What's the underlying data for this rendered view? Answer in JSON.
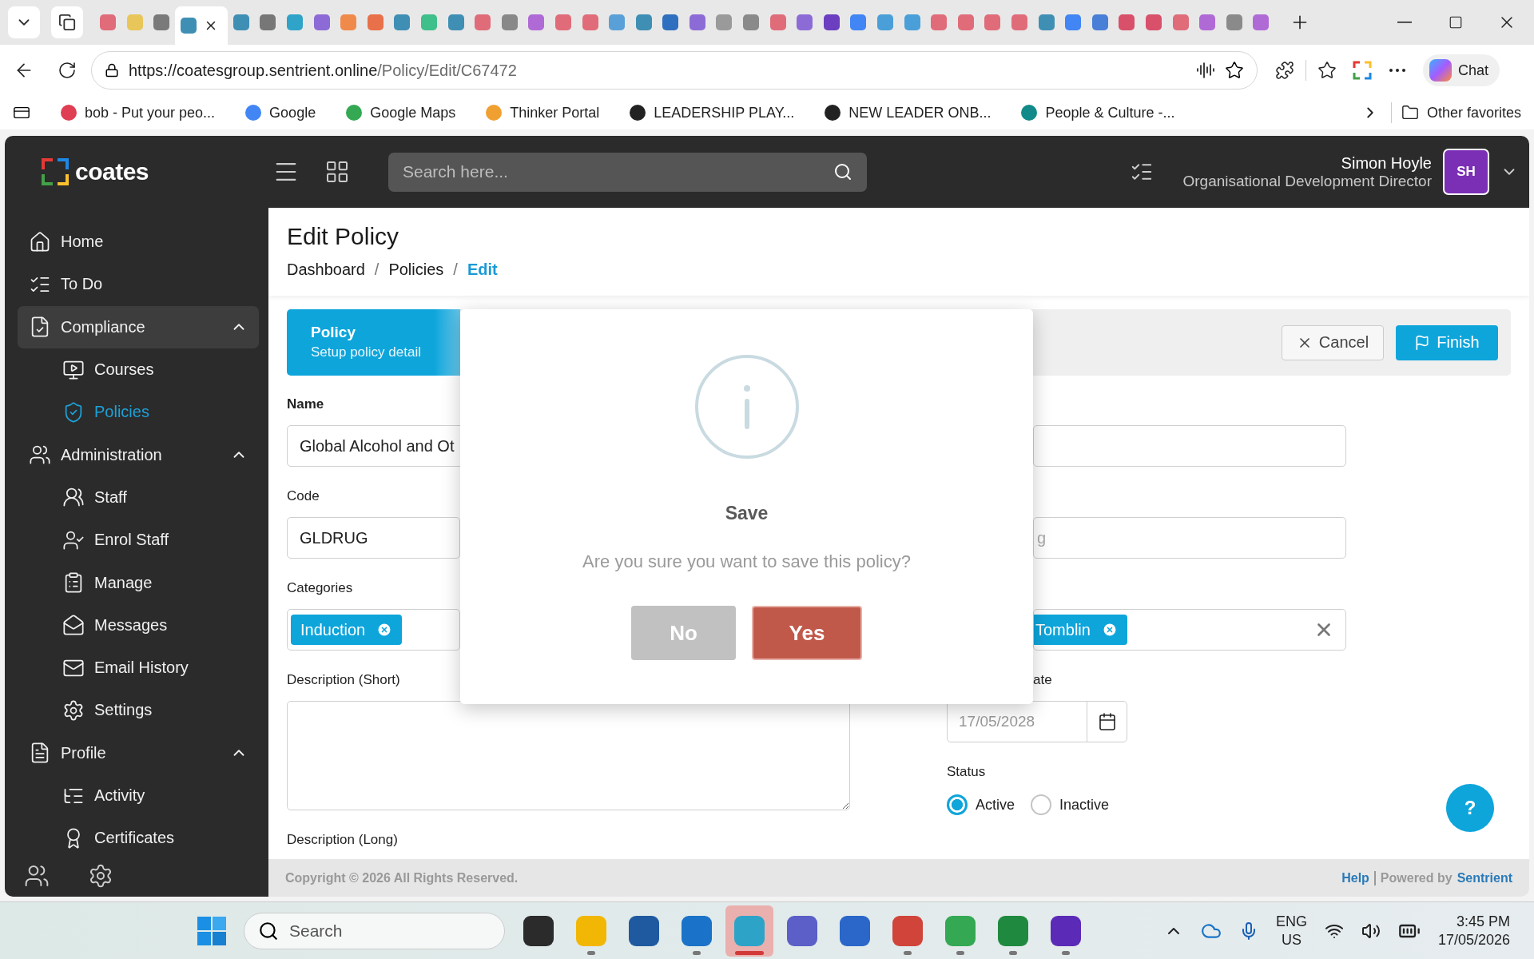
{
  "browser": {
    "tabs": [
      {
        "color": "#e06c7a",
        "selected": false
      },
      {
        "color": "#e8c65a",
        "selected": false
      },
      {
        "color": "#7a7a7a",
        "selected": false
      },
      {
        "color": "#3f8fb5",
        "selected": true
      },
      {
        "color": "#3f8fb5",
        "selected": false
      },
      {
        "color": "#777777",
        "selected": false
      },
      {
        "color": "#2fa3c8",
        "selected": false
      },
      {
        "color": "#8d6bd6",
        "selected": false
      },
      {
        "color": "#f08a4b",
        "selected": false
      },
      {
        "color": "#e8704a",
        "selected": false
      },
      {
        "color": "#3f8fb5",
        "selected": false
      },
      {
        "color": "#3fbf8a",
        "selected": false
      },
      {
        "color": "#3f8fb5",
        "selected": false
      },
      {
        "color": "#e06c7a",
        "selected": false
      },
      {
        "color": "#888888",
        "selected": false
      },
      {
        "color": "#b06ad6",
        "selected": false
      },
      {
        "color": "#e06c7a",
        "selected": false
      },
      {
        "color": "#e06c7a",
        "selected": false
      },
      {
        "color": "#5aa0d8",
        "selected": false
      },
      {
        "color": "#3f8fb5",
        "selected": false
      },
      {
        "color": "#2f6fc0",
        "selected": false
      },
      {
        "color": "#8d6bd6",
        "selected": false
      },
      {
        "color": "#9a9a9a",
        "selected": false
      },
      {
        "color": "#8a8a8a",
        "selected": false
      },
      {
        "color": "#e06c7a",
        "selected": false
      },
      {
        "color": "#8d6bd6",
        "selected": false
      },
      {
        "color": "#6b3fc0",
        "selected": false
      },
      {
        "color": "#4285f4",
        "selected": false
      },
      {
        "color": "#4a9fd8",
        "selected": false
      },
      {
        "color": "#4a9fd8",
        "selected": false
      },
      {
        "color": "#e06c7a",
        "selected": false
      },
      {
        "color": "#e06c7a",
        "selected": false
      },
      {
        "color": "#e06c7a",
        "selected": false
      },
      {
        "color": "#e06c7a",
        "selected": false
      },
      {
        "color": "#3f8fb5",
        "selected": false
      },
      {
        "color": "#4285f4",
        "selected": false
      },
      {
        "color": "#4a7fd8",
        "selected": false
      },
      {
        "color": "#d8506a",
        "selected": false
      },
      {
        "color": "#d8506a",
        "selected": false
      },
      {
        "color": "#e06c7a",
        "selected": false
      },
      {
        "color": "#b06ad6",
        "selected": false
      },
      {
        "color": "#8a8a8a",
        "selected": false
      },
      {
        "color": "#b06ad6",
        "selected": false
      }
    ],
    "url_host": "https://coatesgroup.sentrient.online",
    "url_path": "/Policy/Edit/C67472",
    "chat_label": "Chat",
    "bookmarks": [
      {
        "label": "bob - Put your peo...",
        "color": "#e03e52"
      },
      {
        "label": "Google",
        "color": "#4285f4"
      },
      {
        "label": "Google Maps",
        "color": "#34a853"
      },
      {
        "label": "Thinker Portal",
        "color": "#f0a030"
      },
      {
        "label": "LEADERSHIP PLAY...",
        "color": "#222222"
      },
      {
        "label": "NEW LEADER ONB...",
        "color": "#222222"
      },
      {
        "label": "People & Culture -...",
        "color": "#138a8a"
      }
    ],
    "other_favorites": "Other favorites"
  },
  "app": {
    "brand": "coates",
    "search": {
      "placeholder": "Search here..."
    },
    "user": {
      "name": "Simon Hoyle",
      "role": "Organisational Development Director",
      "initials": "SH"
    },
    "sidebar": [
      {
        "label": "Home",
        "selected": false
      },
      {
        "label": "To Do",
        "selected": false
      },
      {
        "label": "Compliance",
        "selected": true,
        "expanded": true,
        "children": [
          {
            "label": "Courses",
            "selected": false
          },
          {
            "label": "Policies",
            "selected": true
          }
        ]
      },
      {
        "label": "Administration",
        "selected": false,
        "expanded": true,
        "children": [
          {
            "label": "Staff",
            "selected": false
          },
          {
            "label": "Enrol Staff",
            "selected": false
          },
          {
            "label": "Manage",
            "selected": false
          },
          {
            "label": "Messages",
            "selected": false
          },
          {
            "label": "Email History",
            "selected": false
          },
          {
            "label": "Settings",
            "selected": false
          }
        ]
      },
      {
        "label": "Profile",
        "selected": false,
        "expanded": true,
        "children": [
          {
            "label": "Activity",
            "selected": false
          },
          {
            "label": "Certificates",
            "selected": false
          }
        ]
      }
    ]
  },
  "page": {
    "title": "Edit Policy",
    "breadcrumb": [
      {
        "label": "Dashboard",
        "current": false
      },
      {
        "label": "Policies",
        "current": false
      },
      {
        "label": "Edit",
        "current": true
      }
    ],
    "separators": [
      "/",
      "/"
    ]
  },
  "step": {
    "title": "Policy",
    "subtitle": "Setup policy detail"
  },
  "actions": {
    "cancel": "Cancel",
    "finish": "Finish"
  },
  "form": {
    "name": {
      "label": "Name",
      "value": "Global Alcohol and Ot"
    },
    "code": {
      "label": "Code",
      "value": "GLDRUG"
    },
    "categories": {
      "label": "Categories",
      "chips": [
        "Induction"
      ]
    },
    "description_short": {
      "label": "Description (Short)"
    },
    "description_long": {
      "label": "Description (Long)"
    },
    "column_2": {
      "field_2": {
        "placeholder": "g"
      },
      "field_3": {
        "chips": [
          "Tomblin"
        ]
      },
      "date": {
        "label": "ate",
        "placeholder": "17/05/2028"
      },
      "status": {
        "label": "Status",
        "options": [
          {
            "label": "Active",
            "selected": true
          },
          {
            "label": "Inactive",
            "selected": false
          }
        ]
      }
    }
  },
  "modal": {
    "title": "Save",
    "message": "Are you sure you want to save this policy?",
    "buttons": [
      {
        "label": "No",
        "kind": "cancel"
      },
      {
        "label": "Yes",
        "kind": "confirm"
      }
    ]
  },
  "help_button": "?",
  "footer": {
    "copyright": "Copyright © 2026 All Rights Reserved.",
    "help_link": "Help",
    "powered_by": "Powered by",
    "brand_link": "Sentrient"
  },
  "taskbar": {
    "search_placeholder": "Search",
    "apps": [
      {
        "color": "#2b2b2b",
        "running": false,
        "selected": false
      },
      {
        "color": "#f2b705",
        "running": true,
        "selected": false
      },
      {
        "color": "#1f5aa0",
        "running": false,
        "selected": false
      },
      {
        "color": "#1a73c8",
        "running": true,
        "selected": false
      },
      {
        "color": "#2ea3c8",
        "running": true,
        "selected": true
      },
      {
        "color": "#5b5fc7",
        "running": false,
        "selected": false
      },
      {
        "color": "#2b66c9",
        "running": false,
        "selected": false
      },
      {
        "color": "#d0443a",
        "running": true,
        "selected": false
      },
      {
        "color": "#34a853",
        "running": true,
        "selected": false
      },
      {
        "color": "#1f8a3f",
        "running": true,
        "selected": false
      },
      {
        "color": "#5b2bb8",
        "running": true,
        "selected": false
      }
    ],
    "language": [
      "ENG",
      "US"
    ],
    "time": "3:45 PM",
    "date": "17/05/2026"
  }
}
